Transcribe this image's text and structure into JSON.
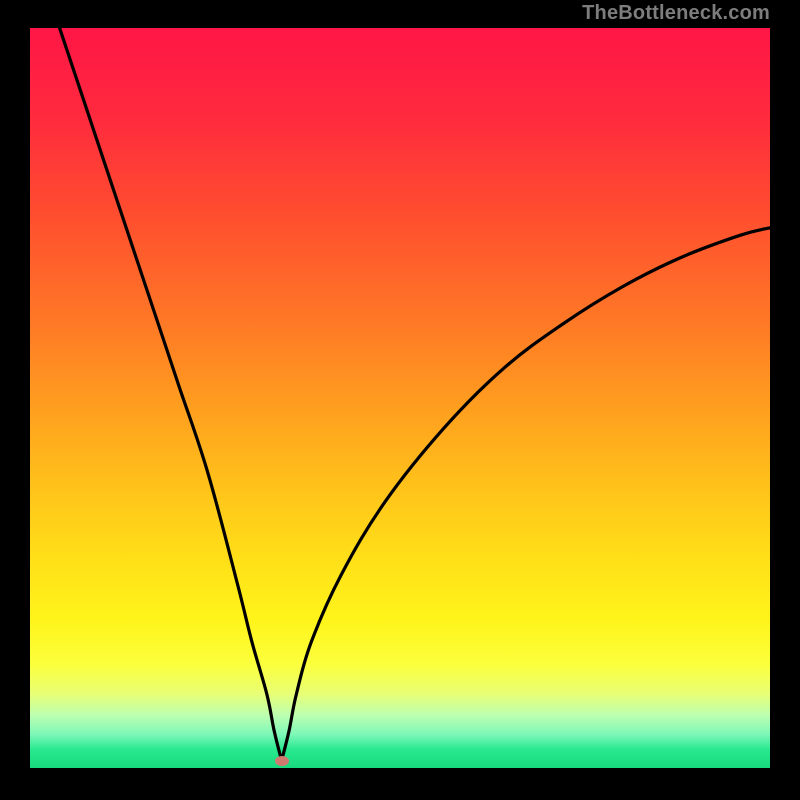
{
  "watermark": "TheBottleneck.com",
  "colors": {
    "gradient_stops": [
      {
        "offset": 0.0,
        "color": "#ff1646"
      },
      {
        "offset": 0.12,
        "color": "#ff2a3e"
      },
      {
        "offset": 0.25,
        "color": "#ff4d2f"
      },
      {
        "offset": 0.38,
        "color": "#ff7327"
      },
      {
        "offset": 0.5,
        "color": "#ff9a1f"
      },
      {
        "offset": 0.62,
        "color": "#ffc21a"
      },
      {
        "offset": 0.72,
        "color": "#ffe018"
      },
      {
        "offset": 0.8,
        "color": "#fff41a"
      },
      {
        "offset": 0.86,
        "color": "#fbff3c"
      },
      {
        "offset": 0.9,
        "color": "#e8ff76"
      },
      {
        "offset": 0.93,
        "color": "#baffb2"
      },
      {
        "offset": 0.955,
        "color": "#7cf7b7"
      },
      {
        "offset": 0.975,
        "color": "#28e98f"
      },
      {
        "offset": 1.0,
        "color": "#18d97e"
      }
    ],
    "curve": "#000000",
    "dot": "#cf7a6f",
    "background": "#000000"
  },
  "chart_data": {
    "type": "line",
    "title": "",
    "xlabel": "",
    "ylabel": "",
    "x_range": [
      0,
      100
    ],
    "y_range": [
      0,
      100
    ],
    "notch_x": 34,
    "dot": {
      "x": 34,
      "y": 1
    },
    "series": [
      {
        "name": "bottleneck-curve",
        "x": [
          0,
          4,
          8,
          12,
          16,
          20,
          24,
          28,
          30,
          32,
          33,
          34,
          35,
          36,
          38,
          42,
          48,
          56,
          64,
          72,
          80,
          88,
          96,
          100
        ],
        "y": [
          112,
          100,
          88,
          76,
          64,
          52,
          40,
          25,
          17,
          10,
          5,
          1,
          5,
          10,
          17,
          26,
          36,
          46,
          54,
          60,
          65,
          69,
          72,
          73
        ]
      }
    ]
  }
}
